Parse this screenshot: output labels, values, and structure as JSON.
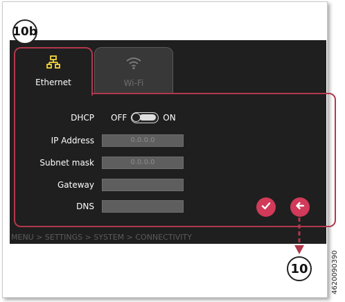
{
  "callouts": {
    "top_left": "10b",
    "bottom_right": "10"
  },
  "tabs": [
    {
      "label": "Ethernet",
      "icon": "ethernet-network-icon",
      "active": true
    },
    {
      "label": "Wi-Fi",
      "icon": "wifi-icon",
      "active": false
    }
  ],
  "dhcp": {
    "label": "DHCP",
    "off_label": "OFF",
    "on_label": "ON",
    "state": "ON"
  },
  "fields": {
    "ip_address": {
      "label": "IP Address",
      "value": "0.0.0.0"
    },
    "subnet_mask": {
      "label": "Subnet mask",
      "value": "0.0.0.0"
    },
    "gateway": {
      "label": "Gateway",
      "value": ""
    },
    "dns": {
      "label": "DNS",
      "value": ""
    }
  },
  "actions": {
    "confirm_icon": "checkmark-icon",
    "back_icon": "arrow-left-icon"
  },
  "breadcrumb": "MENU > SETTINGS > SYSTEM > CONNECTIVITY",
  "document_code": "4620090390",
  "colors": {
    "accent": "#d13a58",
    "panel_border": "#b3384c",
    "screen_bg": "#1f1f1f",
    "ethernet_icon": "#f2d43c"
  }
}
